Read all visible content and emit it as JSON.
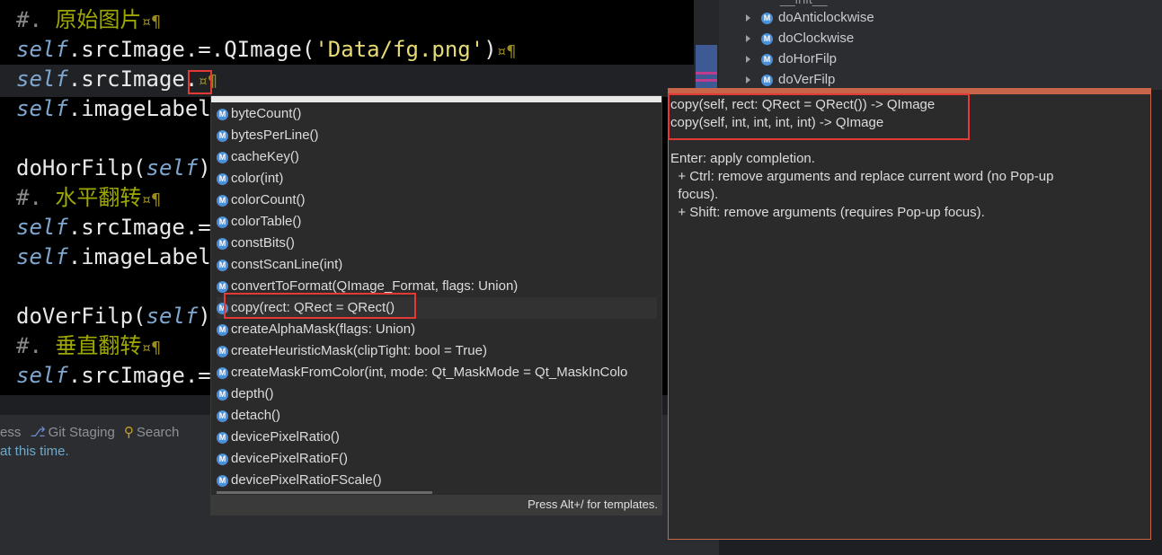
{
  "editor": {
    "lines": [
      {
        "parts": [
          {
            "t": "#. ",
            "c": "cm"
          },
          {
            "t": "原始图片",
            "c": "zh"
          },
          {
            "t": "¤¶",
            "c": "ws"
          }
        ]
      },
      {
        "parts": [
          {
            "t": "self",
            "c": "kw"
          },
          {
            "t": ".srcImage.=.QImage(",
            "c": ""
          },
          {
            "t": "'Data/fg.png'",
            "c": "str"
          },
          {
            "t": ")",
            "c": ""
          },
          {
            "t": "¤¶",
            "c": "ws"
          }
        ]
      },
      {
        "parts": [
          {
            "t": "self",
            "c": "kw"
          },
          {
            "t": ".srcImage.",
            "c": ""
          },
          {
            "t": "¤¶",
            "c": "ws"
          }
        ]
      },
      {
        "parts": [
          {
            "t": "self",
            "c": "kw"
          },
          {
            "t": ".imageLabel",
            "c": ""
          }
        ]
      },
      {
        "parts": []
      },
      {
        "parts": [
          {
            "t": "doHorFilp(",
            "c": ""
          },
          {
            "t": "self",
            "c": "kw"
          },
          {
            "t": ")",
            "c": ""
          }
        ]
      },
      {
        "parts": [
          {
            "t": "#. ",
            "c": "cm"
          },
          {
            "t": "水平翻转",
            "c": "zh"
          },
          {
            "t": "¤¶",
            "c": "ws"
          }
        ]
      },
      {
        "parts": [
          {
            "t": "self",
            "c": "kw"
          },
          {
            "t": ".srcImage.=",
            "c": ""
          }
        ]
      },
      {
        "parts": [
          {
            "t": "self",
            "c": "kw"
          },
          {
            "t": ".imageLabel",
            "c": ""
          }
        ]
      },
      {
        "parts": []
      },
      {
        "parts": [
          {
            "t": "doVerFilp(",
            "c": ""
          },
          {
            "t": "self",
            "c": "kw"
          },
          {
            "t": ")",
            "c": ""
          }
        ]
      },
      {
        "parts": [
          {
            "t": "#. ",
            "c": "cm"
          },
          {
            "t": "垂直翻转",
            "c": "zh"
          },
          {
            "t": "¤¶",
            "c": "ws"
          }
        ]
      },
      {
        "parts": [
          {
            "t": "self",
            "c": "kw"
          },
          {
            "t": ".srcImage.=",
            "c": ""
          }
        ]
      }
    ]
  },
  "outline": {
    "partial_top": "__init__",
    "items": [
      "doAnticlockwise",
      "doClockwise",
      "doHorFilp",
      "doVerFilp"
    ]
  },
  "bottom": {
    "tabs": [
      {
        "label": "ess",
        "icon": null
      },
      {
        "label": "Git Staging",
        "icon": "git-staging-icon"
      },
      {
        "label": "Search",
        "icon": "search-icon"
      }
    ],
    "message": "at this time."
  },
  "completion": {
    "items": [
      "byteCount()",
      "bytesPerLine()",
      "cacheKey()",
      "color(int)",
      "colorCount()",
      "colorTable()",
      "constBits()",
      "constScanLine(int)",
      "convertToFormat(QImage_Format, flags: Union)",
      "copy(rect: QRect = QRect()",
      "createAlphaMask(flags: Union)",
      "createHeuristicMask(clipTight: bool = True)",
      "createMaskFromColor(int, mode: Qt_MaskMode = Qt_MaskInColo",
      "depth()",
      "detach()",
      "devicePixelRatio()",
      "devicePixelRatioF()",
      "devicePixelRatioFScale()"
    ],
    "selected_index": 9,
    "footer": "Press Alt+/ for templates."
  },
  "doc": {
    "signatures": [
      "copy(self, rect: QRect = QRect()) -> QImage",
      "copy(self, int, int, int, int) -> QImage"
    ],
    "help": [
      "Enter: apply completion.",
      "  + Ctrl: remove arguments and replace current word (no Pop-up",
      "  focus).",
      "  + Shift: remove arguments (requires Pop-up focus)."
    ]
  },
  "colors": {
    "editor_bg": "#000000",
    "popup_bg": "#2b2b2b",
    "highlight_box": "#e53935",
    "accent_badge": "#4a8fd8"
  }
}
